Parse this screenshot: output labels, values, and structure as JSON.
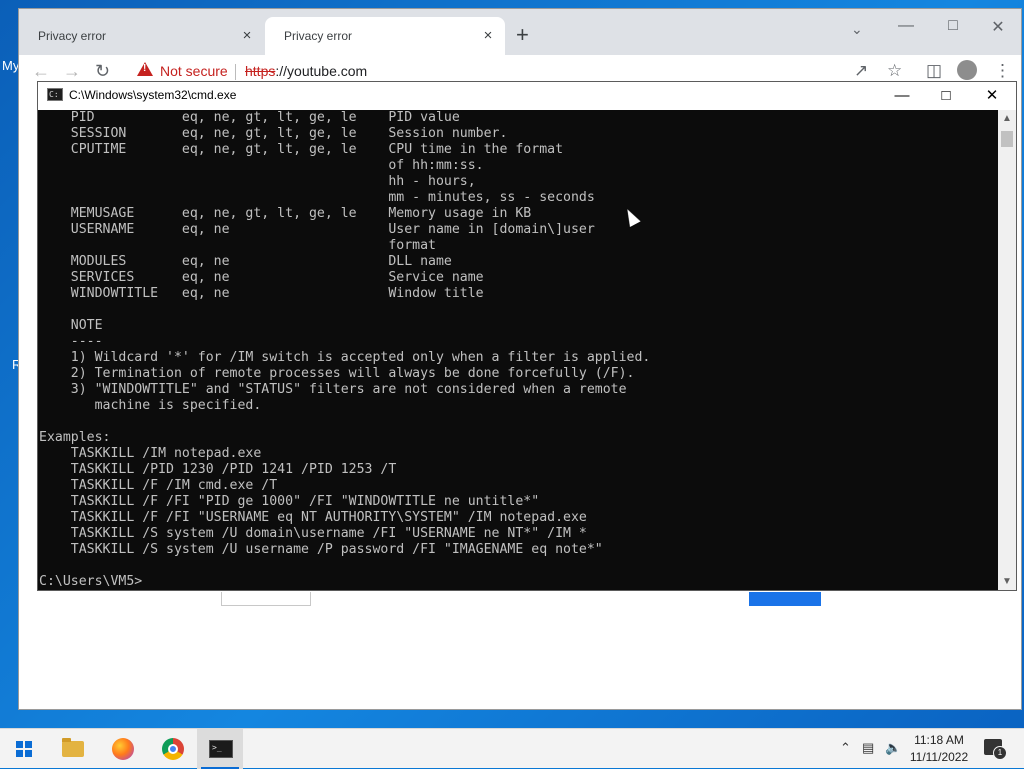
{
  "desktop": {
    "fragments": [
      "My",
      "R"
    ]
  },
  "browser": {
    "tabs": [
      {
        "title": "Privacy error"
      },
      {
        "title": "Privacy error"
      }
    ],
    "new_tab": "+",
    "tab_close": "×",
    "security_text": "Not secure",
    "url_scheme": "https",
    "url_rest": "://youtube.com"
  },
  "cmd": {
    "title": "C:\\Windows\\system32\\cmd.exe",
    "lines": [
      "    PID           eq, ne, gt, lt, ge, le    PID value",
      "    SESSION       eq, ne, gt, lt, ge, le    Session number.",
      "    CPUTIME       eq, ne, gt, lt, ge, le    CPU time in the format",
      "                                            of hh:mm:ss.",
      "                                            hh - hours,",
      "                                            mm - minutes, ss - seconds",
      "    MEMUSAGE      eq, ne, gt, lt, ge, le    Memory usage in KB",
      "    USERNAME      eq, ne                    User name in [domain\\]user",
      "                                            format",
      "    MODULES       eq, ne                    DLL name",
      "    SERVICES      eq, ne                    Service name",
      "    WINDOWTITLE   eq, ne                    Window title",
      "",
      "    NOTE",
      "    ----",
      "    1) Wildcard '*' for /IM switch is accepted only when a filter is applied.",
      "    2) Termination of remote processes will always be done forcefully (/F).",
      "    3) \"WINDOWTITLE\" and \"STATUS\" filters are not considered when a remote",
      "       machine is specified.",
      "",
      "Examples:",
      "    TASKKILL /IM notepad.exe",
      "    TASKKILL /PID 1230 /PID 1241 /PID 1253 /T",
      "    TASKKILL /F /IM cmd.exe /T",
      "    TASKKILL /F /FI \"PID ge 1000\" /FI \"WINDOWTITLE ne untitle*\"",
      "    TASKKILL /F /FI \"USERNAME eq NT AUTHORITY\\SYSTEM\" /IM notepad.exe",
      "    TASKKILL /S system /U domain\\username /FI \"USERNAME ne NT*\" /IM *",
      "    TASKKILL /S system /U username /P password /FI \"IMAGENAME eq note*\"",
      "",
      "C:\\Users\\VM5>"
    ]
  },
  "taskbar": {
    "time": "11:18 AM",
    "date": "11/11/2022",
    "notification_count": "1",
    "accent": "#0a6cd4"
  }
}
